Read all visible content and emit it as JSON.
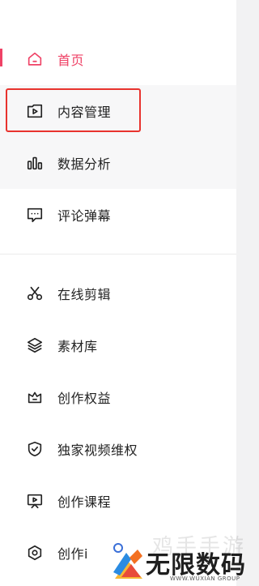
{
  "menu": {
    "items": [
      {
        "label": "首页",
        "icon": "home-icon"
      },
      {
        "label": "内容管理",
        "icon": "play-icon"
      },
      {
        "label": "数据分析",
        "icon": "bar-chart-icon"
      },
      {
        "label": "评论弹幕",
        "icon": "comment-icon"
      },
      {
        "label": "在线剪辑",
        "icon": "scissors-icon"
      },
      {
        "label": "素材库",
        "icon": "layers-icon"
      },
      {
        "label": "创作权益",
        "icon": "crown-icon"
      },
      {
        "label": "独家视频维权",
        "icon": "shield-check-icon"
      },
      {
        "label": "创作课程",
        "icon": "course-icon"
      },
      {
        "label": "创作i",
        "icon": "settings-icon"
      }
    ]
  },
  "watermark": {
    "dim_text": "鸡手手游",
    "main_text": "无限数码",
    "sub_text": "WWW.WUXIAN GROUP"
  },
  "colors": {
    "accent": "#ef4266",
    "highlight_border": "#e8332e"
  }
}
